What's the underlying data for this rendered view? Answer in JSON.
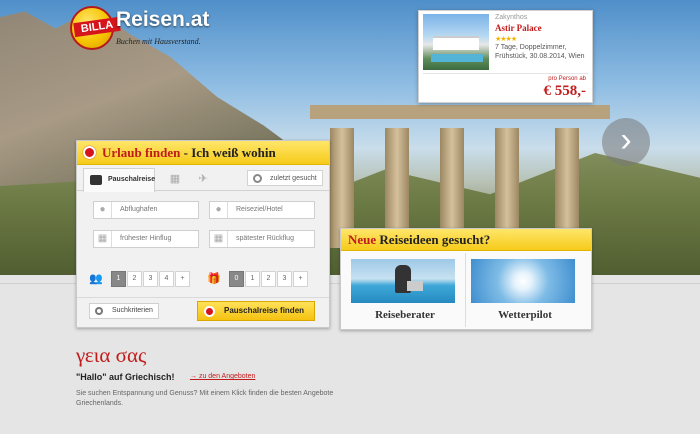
{
  "logo": {
    "brand": "BILLA",
    "text": "Reisen.at",
    "slogan": "Buchen mit Hausverstand."
  },
  "offer": {
    "region": "Zakynthos",
    "hotel": "Astir Palace",
    "stars": "★★★★",
    "description": "7 Tage, Doppelzimmer, Frühstück, 30.08.2014, Wien",
    "per_person_label": "pro Person ab",
    "price": "€ 558,-"
  },
  "search": {
    "title_red": "Urlaub finden",
    "title_black": "- Ich weiß wohin",
    "tab_active": "Pauschalreise",
    "tab_last": "zuletzt gesucht",
    "placeholders": {
      "from": "Abflughafen",
      "to": "Reiseziel/Hotel",
      "earliest": "frühester Hinflug",
      "latest": "spätester Rückflug"
    },
    "adults": [
      "1",
      "2",
      "3",
      "4",
      "+"
    ],
    "children": [
      "0",
      "1",
      "2",
      "3",
      "+"
    ],
    "criteria_label": "Suchkriterien",
    "find_label": "Pauschalreise finden"
  },
  "ideas": {
    "title_red": "Neue",
    "title_black": "Reiseideen gesucht?",
    "item1": "Reiseberater",
    "item2": "Wetterpilot"
  },
  "content": {
    "greek": "γεια σας",
    "hallo": "\"Hallo\" auf Griechisch!",
    "link": "zu den Angeboten",
    "intro": "Sie suchen Entspannung und Genuss? Mit einem Klick finden die besten Angebote Griechenlands."
  },
  "colors": {
    "brand_red": "#c11c1c",
    "brand_yellow": "#f6cb1a"
  },
  "icons": {
    "next": "chevron-right-icon",
    "search_dot": "red-globe-icon"
  }
}
